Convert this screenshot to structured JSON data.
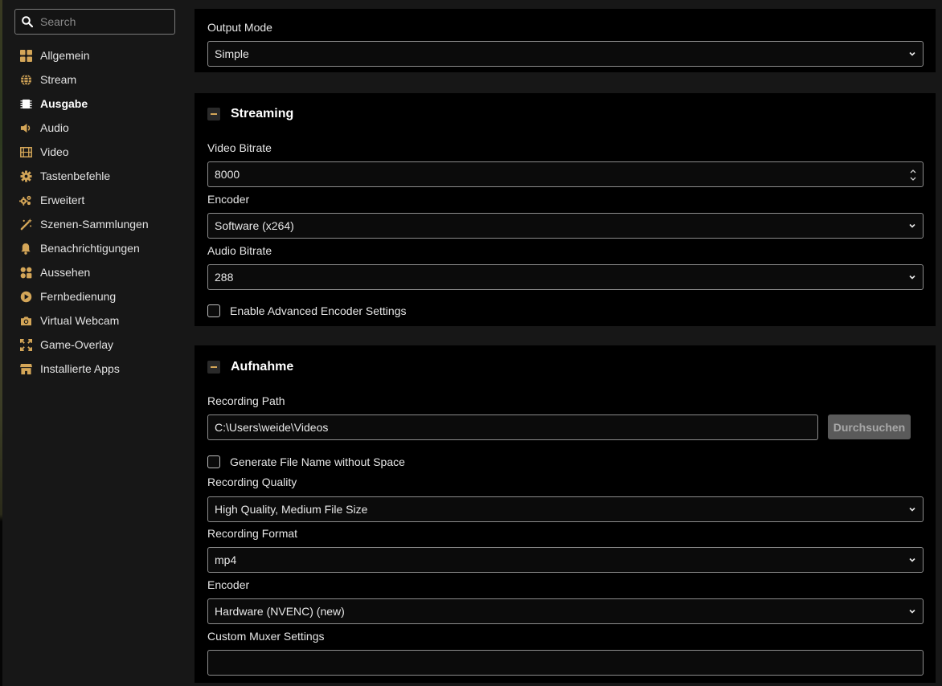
{
  "search": {
    "placeholder": "Search"
  },
  "sidebar": {
    "items": [
      {
        "label": "Allgemein",
        "icon": "grid-icon"
      },
      {
        "label": "Stream",
        "icon": "globe-icon"
      },
      {
        "label": "Ausgabe",
        "icon": "chip-icon",
        "active": true
      },
      {
        "label": "Audio",
        "icon": "speaker-icon"
      },
      {
        "label": "Video",
        "icon": "film-icon"
      },
      {
        "label": "Tastenbefehle",
        "icon": "gear-icon"
      },
      {
        "label": "Erweitert",
        "icon": "gears-icon"
      },
      {
        "label": "Szenen-Sammlungen",
        "icon": "magic-wand-icon"
      },
      {
        "label": "Benachrichtigungen",
        "icon": "bell-icon"
      },
      {
        "label": "Aussehen",
        "icon": "palette-icon"
      },
      {
        "label": "Fernbedienung",
        "icon": "play-circle-icon"
      },
      {
        "label": "Virtual Webcam",
        "icon": "camera-icon"
      },
      {
        "label": "Game-Overlay",
        "icon": "expand-icon"
      },
      {
        "label": "Installierte Apps",
        "icon": "store-icon"
      }
    ]
  },
  "output": {
    "label": "Output Mode",
    "value": "Simple"
  },
  "streaming": {
    "title": "Streaming",
    "video_bitrate_label": "Video Bitrate",
    "video_bitrate": "8000",
    "encoder_label": "Encoder",
    "encoder": "Software (x264)",
    "audio_bitrate_label": "Audio Bitrate",
    "audio_bitrate": "288",
    "advanced_label": "Enable Advanced Encoder Settings"
  },
  "recording": {
    "title": "Aufnahme",
    "path_label": "Recording Path",
    "path": "C:\\Users\\weide\\Videos",
    "browse_label": "Durchsuchen",
    "no_space_label": "Generate File Name without Space",
    "quality_label": "Recording Quality",
    "quality": "High Quality, Medium File Size",
    "format_label": "Recording Format",
    "format": "mp4",
    "encoder_label": "Encoder",
    "encoder": "Hardware (NVENC) (new)",
    "muxer_label": "Custom Muxer Settings",
    "muxer": ""
  },
  "colors": {
    "accent": "#d4a658",
    "panel": "#000000",
    "background": "#171717"
  }
}
